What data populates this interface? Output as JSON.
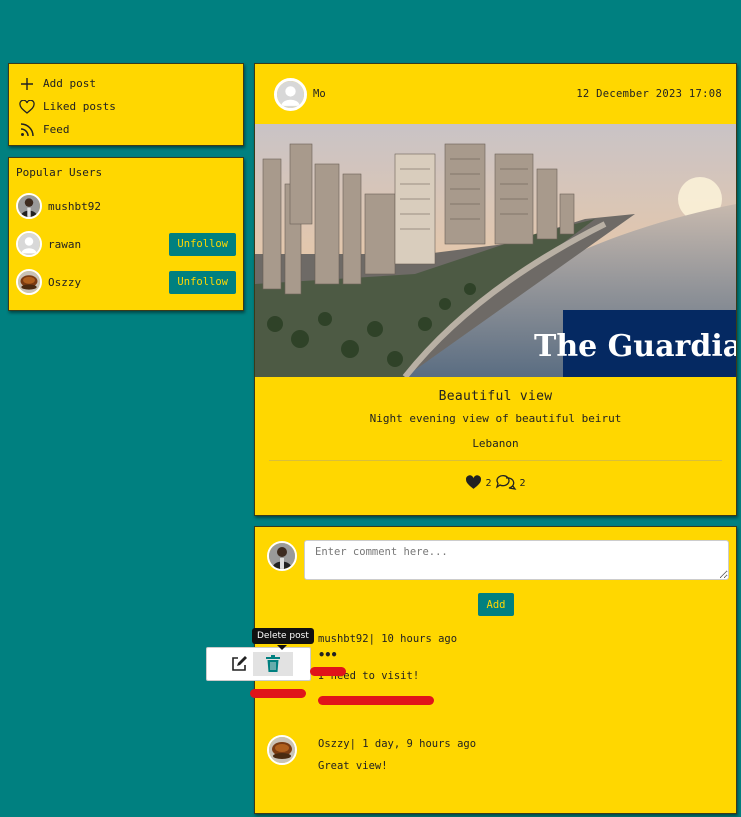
{
  "nav": {
    "items": [
      {
        "label": "Add post",
        "icon": "plus-icon"
      },
      {
        "label": "Liked posts",
        "icon": "heart-icon"
      },
      {
        "label": "Feed",
        "icon": "rss-icon"
      }
    ]
  },
  "popular": {
    "title": "Popular Users",
    "users": [
      {
        "name": "mushbt92",
        "button": ""
      },
      {
        "name": "rawan",
        "button": "Unfollow"
      },
      {
        "name": "Oszzy",
        "button": "Unfollow"
      }
    ]
  },
  "post": {
    "author": "Mo",
    "date": "12 December 2023 17:08",
    "image_watermark": "The Guardian",
    "title": "Beautiful view",
    "description": "Night evening view of beautiful beirut",
    "location": "Lebanon",
    "likes": "2",
    "comments_count": "2"
  },
  "comment_form": {
    "placeholder": "Enter comment here...",
    "add_label": "Add"
  },
  "comments": [
    {
      "author": "mushbt92",
      "time": " | 10 hours ago",
      "menu": "•••",
      "text": "I need to visit!"
    },
    {
      "author": "Oszzy",
      "time": " | 1 day, 9 hours ago",
      "text": "Great view!"
    }
  ],
  "tooltip": "Delete post",
  "colors": {
    "background": "#008080",
    "card": "#FFD700",
    "button": "#008080",
    "delete_icon": "#008080",
    "annotation": "#e0141a"
  }
}
